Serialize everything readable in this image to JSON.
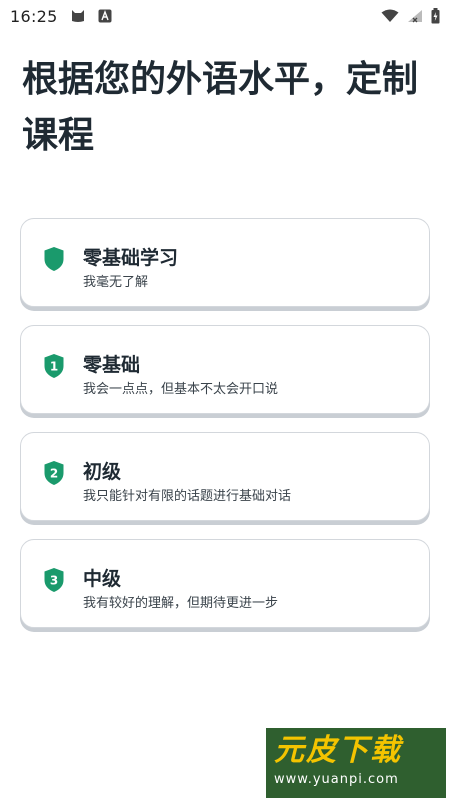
{
  "status_bar": {
    "time": "16:25",
    "icons": [
      "cat-notification-icon",
      "a-notification-icon",
      "wifi-icon",
      "signal-icon",
      "battery-icon"
    ]
  },
  "title": "根据您的外语水平，定制课程",
  "accent_color": "#1a9a6c",
  "options": [
    {
      "badge": "",
      "badge_icon": "shield-icon",
      "title": "零基础学习",
      "desc": "我毫无了解"
    },
    {
      "badge": "1",
      "badge_icon": "shield-number-icon",
      "title": "零基础",
      "desc": "我会一点点，但基本不太会开口说"
    },
    {
      "badge": "2",
      "badge_icon": "shield-number-icon",
      "title": "初级",
      "desc": "我只能针对有限的话题进行基础对话"
    },
    {
      "badge": "3",
      "badge_icon": "shield-number-icon",
      "title": "中级",
      "desc": "我有较好的理解，但期待更进一步"
    }
  ],
  "watermark": {
    "logo_text": "元皮下载",
    "url": "www.yuanpi.com"
  }
}
